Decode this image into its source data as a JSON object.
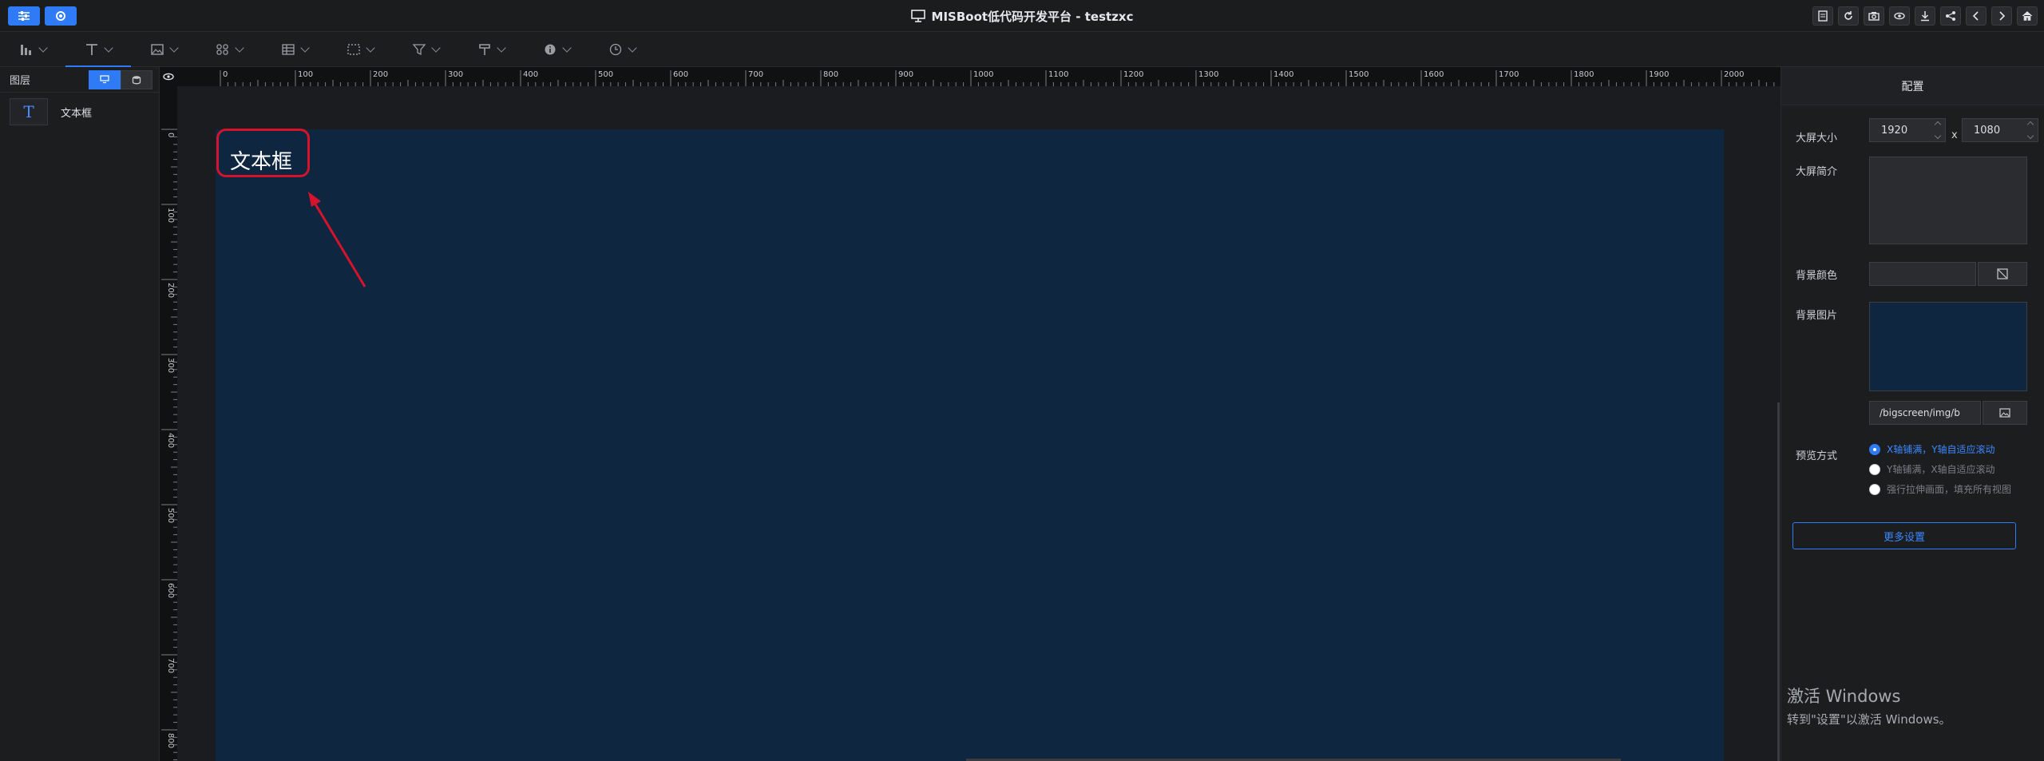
{
  "header": {
    "title": "MISBoot低代码开发平台 - testzxc",
    "left_buttons": [
      "sliders-icon",
      "gear-icon"
    ],
    "right_icons": [
      "notes-icon",
      "refresh-icon",
      "camera-icon",
      "eye-icon",
      "download-icon",
      "share-icon",
      "prev-icon",
      "next-icon",
      "home-icon"
    ]
  },
  "toolbar": {
    "tools": [
      "bar-chart-icon",
      "text-icon",
      "image-icon",
      "grid-icon",
      "table-icon",
      "frame-icon",
      "filter-icon",
      "brush-icon",
      "info-icon",
      "clock-icon"
    ],
    "active_index": 1
  },
  "layers": {
    "title": "图层",
    "items": [
      {
        "label": "文本框",
        "icon": "T"
      }
    ]
  },
  "canvas": {
    "ruler_h_labels": [
      "0",
      "100",
      "200",
      "300",
      "400",
      "500",
      "600",
      "700",
      "800",
      "900",
      "1000",
      "1100",
      "1200",
      "1300",
      "1400",
      "1500",
      "1600",
      "1700",
      "1800",
      "1900",
      "2000"
    ],
    "ruler_v_labels": [
      "0",
      "100",
      "200",
      "300",
      "400",
      "500",
      "600",
      "700",
      "800"
    ],
    "text_component": "文本框",
    "background": "#0e2640"
  },
  "config": {
    "tab": "配置",
    "size_label": "大屏大小",
    "width": "1920",
    "x_label": "x",
    "height": "1080",
    "intro_label": "大屏简介",
    "bg_color_label": "背景颜色",
    "bg_image_label": "背景图片",
    "bg_image_path": "/bigscreen/img/b",
    "preview_label": "预览方式",
    "preview_options": [
      {
        "label": "X轴铺满，Y轴自适应滚动",
        "selected": true
      },
      {
        "label": "Y轴铺满，X轴自适应滚动",
        "selected": false
      },
      {
        "label": "强行拉伸画面，填充所有视图",
        "selected": false
      }
    ],
    "more_button": "更多设置"
  },
  "watermark": {
    "line1": "激活 Windows",
    "line2": "转到\"设置\"以激活 Windows。"
  },
  "colors": {
    "accent": "#2f7bf5",
    "highlight": "#d5142b"
  }
}
